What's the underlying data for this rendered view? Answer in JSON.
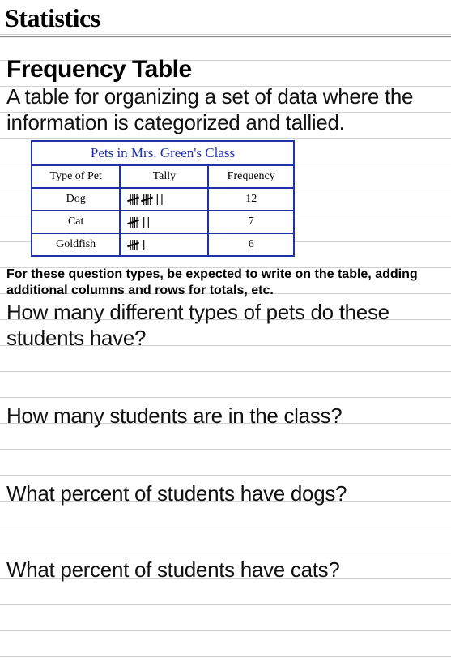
{
  "title": "Statistics",
  "section_heading": "Frequency Table",
  "definition": "A table for organizing a set of data where the information is categorized and tallied.",
  "table": {
    "title": "Pets in Mrs. Green's Class",
    "headers": {
      "c1": "Type of Pet",
      "c2": "Tally",
      "c3": "Frequency"
    },
    "rows": [
      {
        "type": "Dog",
        "tally_fives": 2,
        "tally_ones": 2,
        "frequency": "12"
      },
      {
        "type": "Cat",
        "tally_fives": 1,
        "tally_ones": 2,
        "frequency": "7"
      },
      {
        "type": "Goldfish",
        "tally_fives": 1,
        "tally_ones": 1,
        "frequency": "6"
      }
    ]
  },
  "note": "For these question types, be expected to write on the table, adding additional columns and rows for totals, etc.",
  "questions": {
    "q1": "How many different types of pets do these students have?",
    "q2": "How many students are in the class?",
    "q3": "What percent of students have dogs?",
    "q4": "What percent of students have cats?"
  }
}
